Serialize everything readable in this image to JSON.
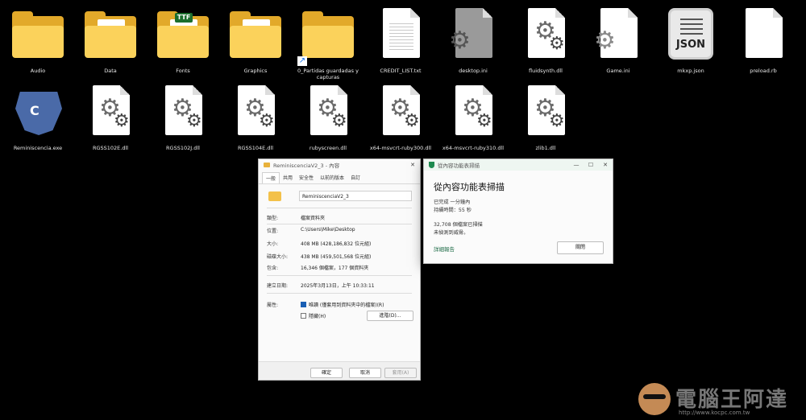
{
  "desktop": {
    "row1": [
      {
        "label": "Audio",
        "icon": "folder-icon"
      },
      {
        "label": "Data",
        "icon": "folder-icon"
      },
      {
        "label": "Fonts",
        "icon": "font-folder-icon",
        "badge": "TTF"
      },
      {
        "label": "Graphics",
        "icon": "folder-icon"
      },
      {
        "label": "0_Partidas guardadas y capturas",
        "icon": "shortcut-folder-icon"
      },
      {
        "label": "CREDIT_LIST.txt",
        "icon": "text-file-icon"
      },
      {
        "label": "desktop.ini",
        "icon": "settings-file-icon"
      },
      {
        "label": "fluidsynth.dll",
        "icon": "dll-file-icon"
      },
      {
        "label": "Game.ini",
        "icon": "settings-file-icon"
      },
      {
        "label": "mkxp.json",
        "icon": "json-file-icon",
        "badge": "JSON"
      },
      {
        "label": "preload.rb",
        "icon": "blank-file-icon"
      }
    ],
    "row2": [
      {
        "label": "Reminiscencia.exe",
        "icon": "game-exe-icon",
        "glyph": "C"
      },
      {
        "label": "RGSS102E.dll",
        "icon": "dll-file-icon"
      },
      {
        "label": "RGSS102J.dll",
        "icon": "dll-file-icon"
      },
      {
        "label": "RGSS104E.dll",
        "icon": "dll-file-icon"
      },
      {
        "label": "rubyscreen.dll",
        "icon": "dll-file-icon"
      },
      {
        "label": "x64-msvcrt-ruby300.dll",
        "icon": "dll-file-icon"
      },
      {
        "label": "x64-msvcrt-ruby310.dll",
        "icon": "dll-file-icon"
      },
      {
        "label": "zlib1.dll",
        "icon": "dll-file-icon"
      }
    ]
  },
  "properties": {
    "title": "ReminiscenciaV2_3 - 內容",
    "close": "✕",
    "tabs": [
      "一般",
      "共用",
      "安全性",
      "以前的版本",
      "自訂"
    ],
    "name_value": "ReminiscenciaV2_3",
    "rows": [
      {
        "label": "類型:",
        "value": "檔案資料夾"
      },
      {
        "label": "位置:",
        "value": "C:\\Users\\Mike\\Desktop"
      },
      {
        "label": "大小:",
        "value": "408 MB (428,186,832 位元組)"
      },
      {
        "label": "磁碟大小:",
        "value": "438 MB (459,501,568 位元組)"
      },
      {
        "label": "包含:",
        "value": "16,346 個檔案，177 個資料夾"
      },
      {
        "label": "建立日期:",
        "value": "2025年3月13日，上午 10:33:11"
      }
    ],
    "attributes_label": "屬性:",
    "readonly_label": "唯讀 (僅套用到資料夾中的檔案)(R)",
    "hidden_label": "隱藏(H)",
    "advanced_button": "進階(D)...",
    "ok_button": "確定",
    "cancel_button": "取消",
    "apply_button": "套用(A)"
  },
  "scan": {
    "titlebar": "從內容功能表掃描",
    "minimize": "—",
    "maximize": "☐",
    "close": "✕",
    "heading": "從內容功能表掃描",
    "line1": "已完成 一分鐘內",
    "line2": "持續時間：55 秒",
    "line3": "32,708 個檔案已掃描",
    "line4": "未偵測到威脅。",
    "report_link": "詳細報告",
    "close_button": "關閉"
  },
  "watermark": {
    "text": "電腦王阿達",
    "url": "http://www.kocpc.com.tw"
  }
}
